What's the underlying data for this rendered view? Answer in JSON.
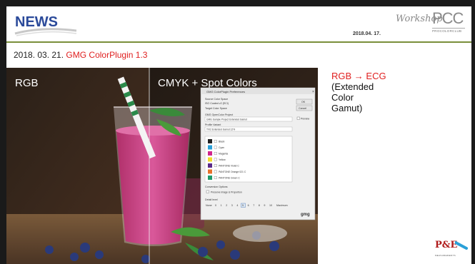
{
  "header": {
    "news_logo": "NEWS",
    "date": "2018.04. 17.",
    "workshop": "Workshop",
    "pcc": "PCC",
    "pcc_sub": "PROCOLORCLUB"
  },
  "slide": {
    "title_date": "2018. 03. 21. ",
    "title_product": "GMG ColorPlugin 1.3",
    "caption_line1": "RGB → ECG",
    "caption_rest": [
      "(Extended",
      "Color",
      "Gamut)"
    ]
  },
  "photo": {
    "left_label": "RGB",
    "right_label": "CMYK + Spot Colors"
  },
  "dialog": {
    "title": "GMG ColorPlugin Preferences",
    "source_label": "Source Color Space",
    "source_value": "ISO Coated v2 (ECI)",
    "target_label": "Target Color Space",
    "project_label": "GMG OpenColor Project",
    "project_value": "GMG Sample Project Extended Gamut",
    "profile_label": "Profile Variant",
    "profile_value": "TVI2 Extended Gamut 12%",
    "ok": "OK",
    "cancel": "Cancel",
    "preview": "Preview",
    "swatches": [
      "Black",
      "Cyan",
      "Magenta",
      "Yellow",
      "PANTONE Violet C",
      "PANTONE Orange 021 C",
      "PANTONE Green C"
    ],
    "swatch_colors": [
      "#222222",
      "#2aa0d8",
      "#d0258c",
      "#f2dc2a",
      "#5a2a8a",
      "#e8702a",
      "#1f9a6a"
    ],
    "conversion_label": "Conversion Options",
    "conversion_opt": "Preserve Image & Proportion",
    "detail_label": "Detail level",
    "detail_prefix": "None",
    "detail_levels": [
      "0",
      "1",
      "2",
      "3",
      "4",
      "5",
      "6",
      "7",
      "8",
      "9",
      "10"
    ],
    "detail_max": "Maximum",
    "brand": "gmg"
  },
  "footer": {
    "pe": "P&E",
    "pe_sub": "MEASUREMENTS"
  },
  "colors": {
    "accent_red": "#e02020",
    "news_blue": "#2b4a9a",
    "rule_green": "#7a8f3a"
  }
}
